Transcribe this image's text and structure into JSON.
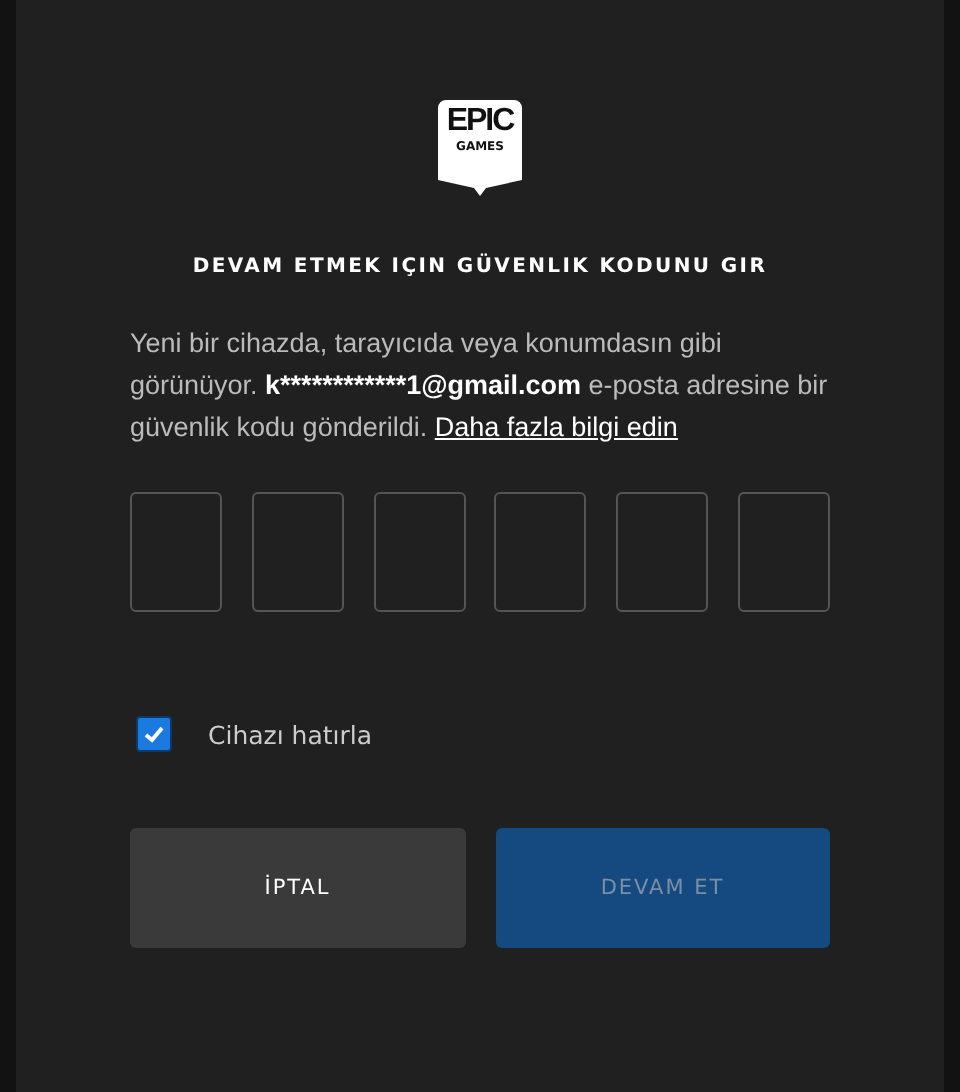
{
  "logo": {
    "top": "EPIC",
    "bottom": "GAMES"
  },
  "title": "DEVAM ETMEK IÇIN GÜVENLIK KODUNU GIR",
  "message": {
    "before": "Yeni bir cihazda, tarayıcıda veya konumdasın gibi görünüyor.",
    "email": "k************1@gmail.com",
    "after": "e-posta adresine bir güvenlik kodu gönderildi."
  },
  "learn_more_link": "Daha fazla bilgi edin",
  "code_fields": [
    {
      "focused": false
    },
    {
      "focused": false
    },
    {
      "focused": false
    },
    {
      "focused": false
    },
    {
      "focused": false
    },
    {
      "focused": false
    }
  ],
  "remember_device": {
    "label": "Cihazı hatırla",
    "checked": true
  },
  "buttons": [
    {
      "label": "İPTAL",
      "kind": "cancel",
      "disabled": false
    },
    {
      "label": "DEVAM ET",
      "kind": "primary",
      "disabled": true
    }
  ]
}
